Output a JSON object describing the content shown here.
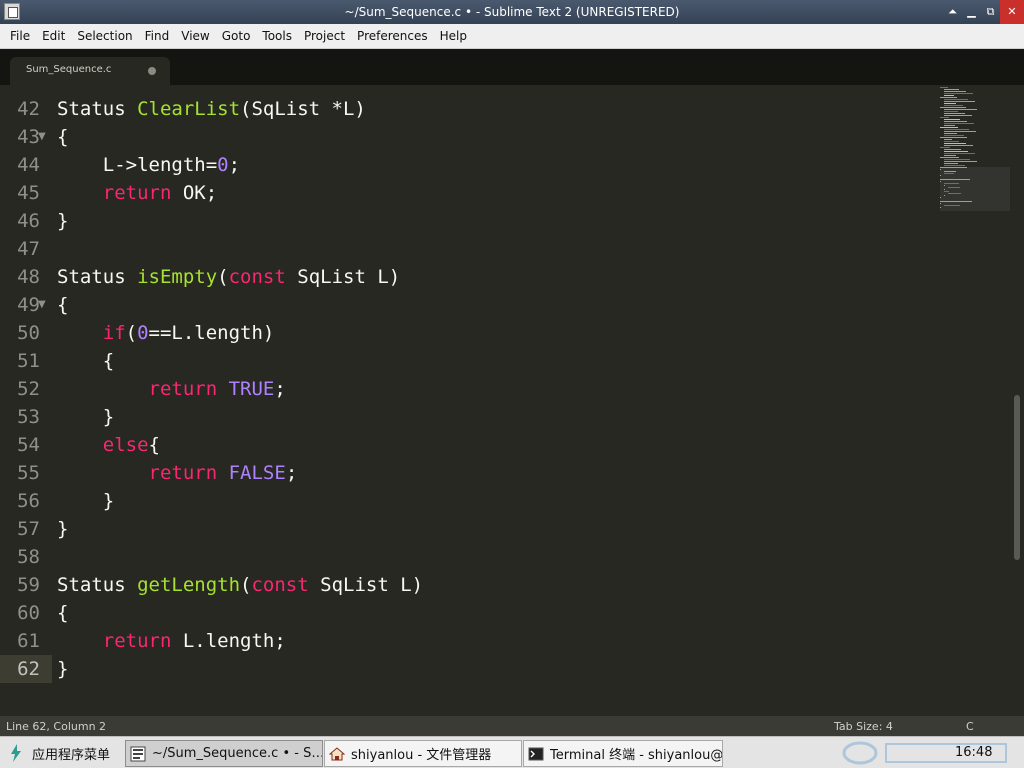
{
  "window": {
    "title": "~/Sum_Sequence.c  •   - Sublime Text 2 (UNREGISTERED)"
  },
  "menu": [
    "File",
    "Edit",
    "Selection",
    "Find",
    "View",
    "Goto",
    "Tools",
    "Project",
    "Preferences",
    "Help"
  ],
  "tab": {
    "label": "Sum_Sequence.c"
  },
  "editor": {
    "current_line": 62,
    "lines": [
      {
        "n": "42",
        "fold": false,
        "tokens": [
          [
            "ty",
            "Status "
          ],
          [
            "fn",
            "ClearList"
          ],
          [
            "pl",
            "(SqList *L)"
          ]
        ]
      },
      {
        "n": "43",
        "fold": true,
        "tokens": [
          [
            "pl",
            "{"
          ]
        ]
      },
      {
        "n": "44",
        "fold": false,
        "tokens": [
          [
            "pl",
            "    L->length="
          ],
          [
            "num",
            "0"
          ],
          [
            "pl",
            ";"
          ]
        ]
      },
      {
        "n": "45",
        "fold": false,
        "tokens": [
          [
            "kw",
            "    return"
          ],
          [
            "pl",
            " OK;"
          ]
        ]
      },
      {
        "n": "46",
        "fold": false,
        "tokens": [
          [
            "pl",
            "}"
          ]
        ]
      },
      {
        "n": "47",
        "fold": false,
        "tokens": []
      },
      {
        "n": "48",
        "fold": false,
        "tokens": [
          [
            "ty",
            "Status "
          ],
          [
            "fn",
            "isEmpty"
          ],
          [
            "pl",
            "("
          ],
          [
            "kw",
            "const"
          ],
          [
            "pl",
            " SqList L)"
          ]
        ]
      },
      {
        "n": "49",
        "fold": true,
        "tokens": [
          [
            "pl",
            "{"
          ]
        ]
      },
      {
        "n": "50",
        "fold": false,
        "tokens": [
          [
            "kw",
            "    if"
          ],
          [
            "pl",
            "("
          ],
          [
            "num",
            "0"
          ],
          [
            "pl",
            "==L.length)"
          ]
        ]
      },
      {
        "n": "51",
        "fold": false,
        "tokens": [
          [
            "pl",
            "    {"
          ]
        ]
      },
      {
        "n": "52",
        "fold": false,
        "tokens": [
          [
            "kw",
            "        return"
          ],
          [
            "pl",
            " "
          ],
          [
            "cn",
            "TRUE"
          ],
          [
            "pl",
            ";"
          ]
        ]
      },
      {
        "n": "53",
        "fold": false,
        "tokens": [
          [
            "pl",
            "    }"
          ]
        ]
      },
      {
        "n": "54",
        "fold": false,
        "tokens": [
          [
            "kw",
            "    else"
          ],
          [
            "pl",
            "{"
          ]
        ]
      },
      {
        "n": "55",
        "fold": false,
        "tokens": [
          [
            "kw",
            "        return"
          ],
          [
            "pl",
            " "
          ],
          [
            "cn",
            "FALSE"
          ],
          [
            "pl",
            ";"
          ]
        ]
      },
      {
        "n": "56",
        "fold": false,
        "tokens": [
          [
            "pl",
            "    }"
          ]
        ]
      },
      {
        "n": "57",
        "fold": false,
        "tokens": [
          [
            "pl",
            "}"
          ]
        ]
      },
      {
        "n": "58",
        "fold": false,
        "tokens": []
      },
      {
        "n": "59",
        "fold": false,
        "tokens": [
          [
            "ty",
            "Status "
          ],
          [
            "fn",
            "getLength"
          ],
          [
            "pl",
            "("
          ],
          [
            "kw",
            "const"
          ],
          [
            "pl",
            " SqList L)"
          ]
        ]
      },
      {
        "n": "60",
        "fold": false,
        "tokens": [
          [
            "pl",
            "{"
          ]
        ]
      },
      {
        "n": "61",
        "fold": false,
        "tokens": [
          [
            "kw",
            "    return"
          ],
          [
            "pl",
            " L.length;"
          ]
        ]
      },
      {
        "n": "62",
        "fold": false,
        "tokens": [
          [
            "pl",
            "}"
          ]
        ]
      }
    ]
  },
  "status": {
    "position": "Line 62, Column 2",
    "tab_size": "Tab Size: 4",
    "syntax": "C"
  },
  "taskbar": {
    "menu_label": "应用程序菜单",
    "tasks": [
      {
        "label": "~/Sum_Sequence.c  •  - S…",
        "icon": "sublime-icon",
        "active": true
      },
      {
        "label": "shiyanlou - 文件管理器",
        "icon": "home-folder-icon",
        "active": false
      },
      {
        "label": "Terminal 终端 - shiyanlou@…",
        "icon": "terminal-icon",
        "active": false
      }
    ],
    "clock": "16:48"
  },
  "colors": {
    "background": "#272822",
    "keyword": "#f92672",
    "function": "#a6e22e",
    "constant": "#ae81ff",
    "foreground": "#f8f8f2"
  }
}
